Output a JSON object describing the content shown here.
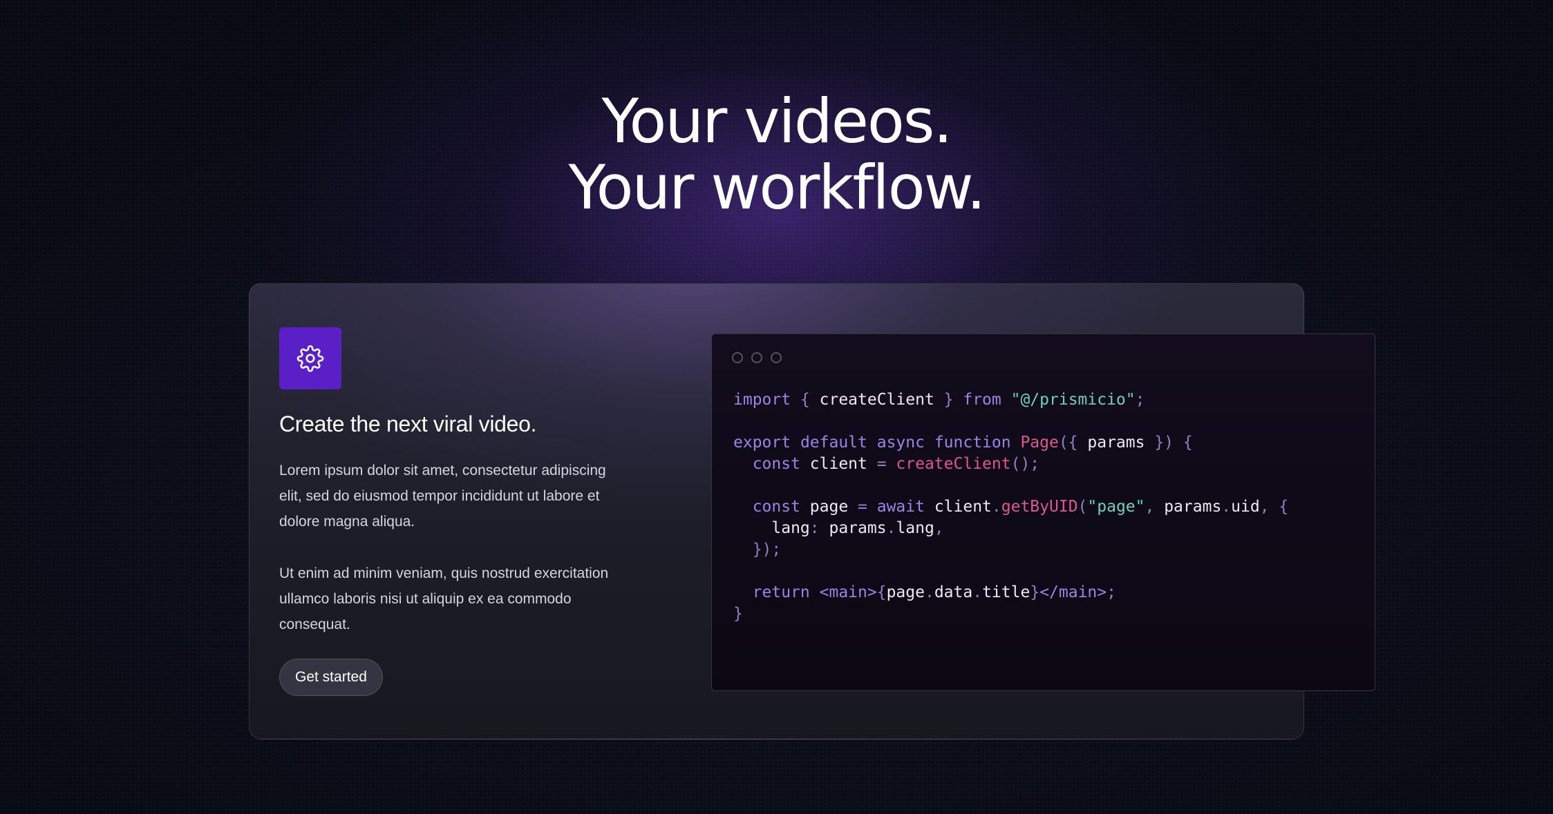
{
  "hero": {
    "title_line1": "Your videos.",
    "title_line2": "Your workflow."
  },
  "feature": {
    "icon": "gear-icon",
    "title": "Create the next viral video.",
    "paragraph1": "Lorem ipsum dolor sit amet, consectetur adipiscing elit, sed do eiusmod tempor incididunt ut labore et dolore magna aliqua.",
    "paragraph2": "Ut enim ad minim veniam, quis nostrud exercitation ullamco laboris nisi ut aliquip ex ea commodo consequat.",
    "cta_label": "Get started"
  },
  "code_window": {
    "lines": [
      [
        {
          "t": "import ",
          "c": "kw"
        },
        {
          "t": "{ ",
          "c": "pn"
        },
        {
          "t": "createClient",
          "c": "id"
        },
        {
          "t": " } ",
          "c": "pn"
        },
        {
          "t": "from ",
          "c": "kw"
        },
        {
          "t": "\"@/prismicio\"",
          "c": "st"
        },
        {
          "t": ";",
          "c": "pn"
        }
      ],
      [],
      [
        {
          "t": "export ",
          "c": "kw"
        },
        {
          "t": "default ",
          "c": "kw"
        },
        {
          "t": "async ",
          "c": "kw"
        },
        {
          "t": "function ",
          "c": "kw"
        },
        {
          "t": "Page",
          "c": "fn"
        },
        {
          "t": "({ ",
          "c": "pn"
        },
        {
          "t": "params",
          "c": "id"
        },
        {
          "t": " }) {",
          "c": "pn"
        }
      ],
      [
        {
          "t": "  const ",
          "c": "kw"
        },
        {
          "t": "client",
          "c": "id"
        },
        {
          "t": " = ",
          "c": "pn"
        },
        {
          "t": "createClient",
          "c": "fn"
        },
        {
          "t": "();",
          "c": "pn"
        }
      ],
      [],
      [
        {
          "t": "  const ",
          "c": "kw"
        },
        {
          "t": "page",
          "c": "id"
        },
        {
          "t": " = ",
          "c": "pn"
        },
        {
          "t": "await ",
          "c": "kw"
        },
        {
          "t": "client",
          "c": "id"
        },
        {
          "t": ".",
          "c": "pn"
        },
        {
          "t": "getByUID",
          "c": "fn"
        },
        {
          "t": "(",
          "c": "pn"
        },
        {
          "t": "\"page\"",
          "c": "st"
        },
        {
          "t": ", ",
          "c": "pn"
        },
        {
          "t": "params",
          "c": "id"
        },
        {
          "t": ".",
          "c": "pn"
        },
        {
          "t": "uid",
          "c": "id"
        },
        {
          "t": ", {",
          "c": "pn"
        }
      ],
      [
        {
          "t": "    lang",
          "c": "id"
        },
        {
          "t": ": ",
          "c": "pn"
        },
        {
          "t": "params",
          "c": "id"
        },
        {
          "t": ".",
          "c": "pn"
        },
        {
          "t": "lang",
          "c": "id"
        },
        {
          "t": ",",
          "c": "pn"
        }
      ],
      [
        {
          "t": "  });",
          "c": "pn"
        }
      ],
      [],
      [
        {
          "t": "  return ",
          "c": "kw"
        },
        {
          "t": "<main>",
          "c": "kw"
        },
        {
          "t": "{",
          "c": "pn"
        },
        {
          "t": "page",
          "c": "id"
        },
        {
          "t": ".",
          "c": "pn"
        },
        {
          "t": "data",
          "c": "id"
        },
        {
          "t": ".",
          "c": "pn"
        },
        {
          "t": "title",
          "c": "id"
        },
        {
          "t": "}",
          "c": "pn"
        },
        {
          "t": "</main>",
          "c": "kw"
        },
        {
          "t": ";",
          "c": "pn"
        }
      ],
      [
        {
          "t": "}",
          "c": "pn"
        }
      ]
    ]
  }
}
